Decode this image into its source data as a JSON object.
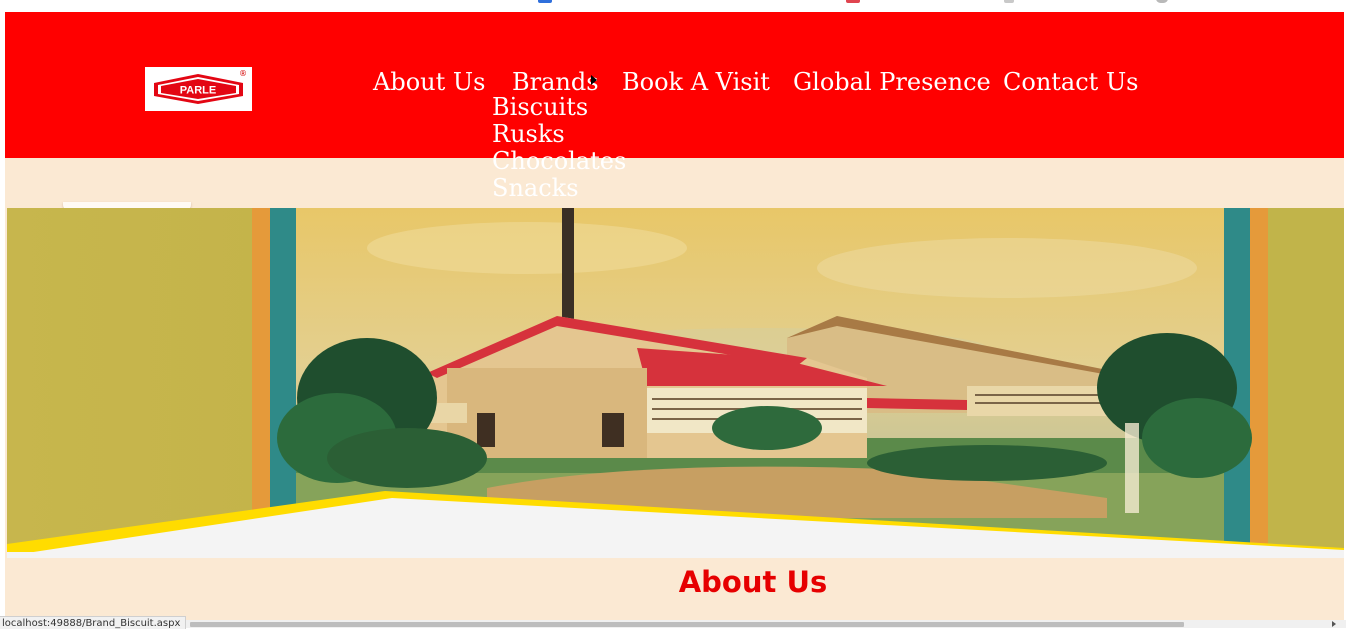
{
  "brand": {
    "logo_text": "PARLE",
    "registered_mark": "®"
  },
  "nav": {
    "items": [
      {
        "label": "About Us"
      },
      {
        "label": "Brands"
      },
      {
        "label": "Book A Visit"
      },
      {
        "label": "Global Presence"
      },
      {
        "label": "Contact Us"
      }
    ],
    "brands_submenu": [
      {
        "label": "Biscuits"
      },
      {
        "label": "Rusks"
      },
      {
        "label": "Chocolates"
      },
      {
        "label": "Snacks"
      }
    ]
  },
  "main": {
    "section_title": "About Us"
  },
  "status_bar": {
    "link_preview": "localhost:49888/Brand_Biscuit.aspx"
  },
  "colors": {
    "header_bg": "#ff0000",
    "page_bg": "#fbe9d3",
    "nav_text": "#ffffff",
    "title_text": "#e60000",
    "accent_yellow": "#ffdc00"
  },
  "icons": {
    "brands_arrow": "caret-right-icon",
    "scroll_right": "scroll-right-icon"
  }
}
